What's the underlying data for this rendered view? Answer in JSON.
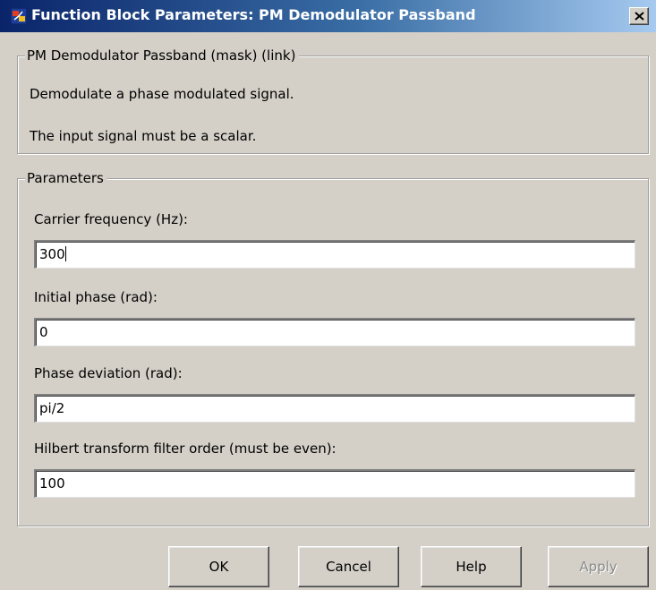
{
  "window": {
    "title": "Function Block Parameters: PM Demodulator Passband",
    "close_label": "×"
  },
  "description": {
    "legend": "PM Demodulator Passband (mask) (link)",
    "line1": "Demodulate a phase modulated signal.",
    "line2": "The input signal must be a scalar."
  },
  "parameters": {
    "legend": "Parameters",
    "fields": [
      {
        "label": "Carrier frequency (Hz):",
        "value": "300"
      },
      {
        "label": "Initial phase (rad):",
        "value": "0"
      },
      {
        "label": "Phase deviation (rad):",
        "value": "pi/2"
      },
      {
        "label": "Hilbert transform filter order (must be even):",
        "value": "100"
      }
    ]
  },
  "buttons": {
    "ok": "OK",
    "cancel": "Cancel",
    "help": "Help",
    "apply": "Apply"
  },
  "icons": {
    "app": "simulink-block-icon",
    "close": "close-icon"
  },
  "colors": {
    "title_start": "#0a246a",
    "title_end": "#a6caf0",
    "dialog_bg": "#d4d0c8"
  }
}
